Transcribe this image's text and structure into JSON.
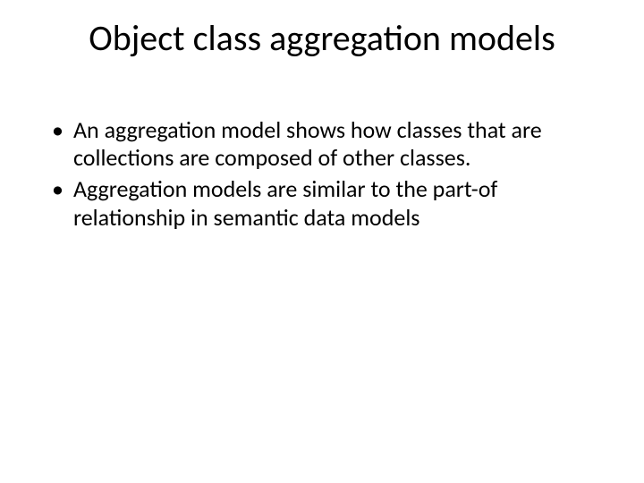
{
  "slide": {
    "title": "Object class aggregation models",
    "bullets": [
      "An aggregation model shows how classes that are collections are composed of other classes.",
      "Aggregation models are similar to the part-of relationship in semantic data models"
    ]
  }
}
